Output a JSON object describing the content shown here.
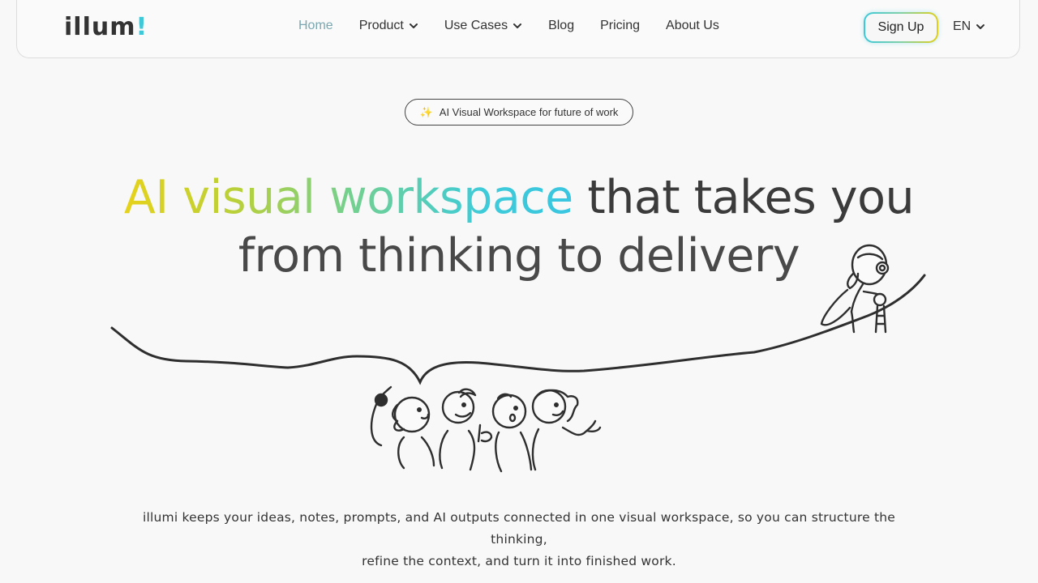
{
  "nav": {
    "logo": {
      "prefix": "illum",
      "suffix": "!",
      "full": "illumi"
    },
    "links": [
      {
        "label": "Home",
        "active": true,
        "dropdown": false
      },
      {
        "label": "Product",
        "active": false,
        "dropdown": true
      },
      {
        "label": "Use Cases",
        "active": false,
        "dropdown": true
      },
      {
        "label": "Blog",
        "active": false,
        "dropdown": false
      },
      {
        "label": "Pricing",
        "active": false,
        "dropdown": false
      },
      {
        "label": "About Us",
        "active": false,
        "dropdown": false
      }
    ],
    "signup_label": "Sign Up",
    "language": "EN"
  },
  "badge": {
    "icon": "sparkle-icon",
    "text": "AI Visual Workspace for future of work"
  },
  "hero": {
    "highlight": "AI visual workspace",
    "rest_line1": " that takes you",
    "line2": "from thinking to delivery"
  },
  "description": {
    "line1": "illumi keeps your ideas, notes, prompts, and AI outputs connected in one visual workspace, so you can structure the thinking,",
    "line2": "refine the context, and turn it into finished work."
  },
  "colors": {
    "accent_yellow": "#e2cf16",
    "accent_cyan": "#3ec8d8",
    "active_nav": "#7aa7b0",
    "background": "#f8f8f8"
  }
}
